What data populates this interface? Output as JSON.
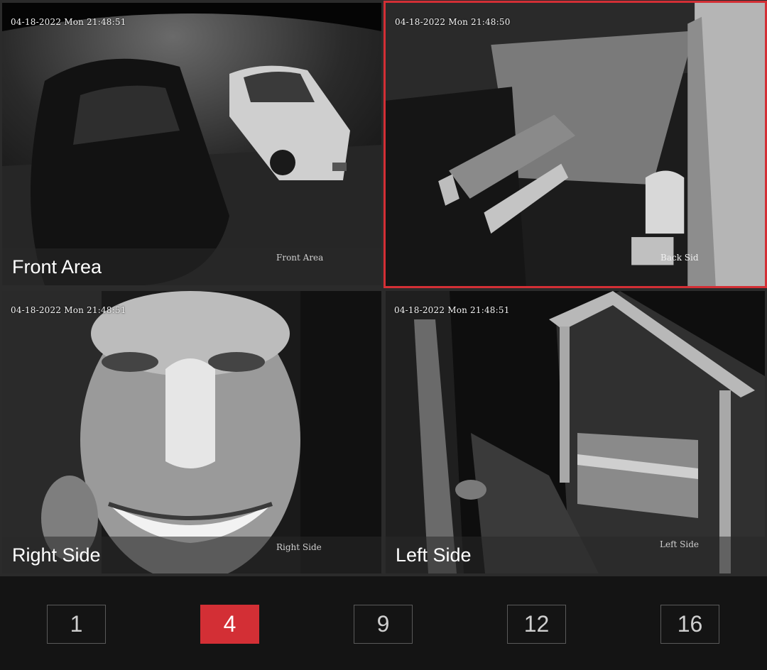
{
  "cameras": [
    {
      "timestamp": "04-18-2022 Mon 21:48:51",
      "osd_name": "Front Area",
      "label": "Front Area",
      "selected": false
    },
    {
      "timestamp": "04-18-2022 Mon 21:48:50",
      "osd_name": "Back Sid",
      "label": "",
      "selected": true
    },
    {
      "timestamp": "04-18-2022 Mon 21:48:51",
      "osd_name": "Right Side",
      "label": "Right Side",
      "selected": false
    },
    {
      "timestamp": "04-18-2022 Mon 21:48:51",
      "osd_name": "Left Side",
      "label": "Left Side",
      "selected": false
    }
  ],
  "layout_options": [
    {
      "label": "1"
    },
    {
      "label": "4",
      "active": true
    },
    {
      "label": "9"
    },
    {
      "label": "12"
    },
    {
      "label": "16"
    }
  ],
  "colors": {
    "accent": "#d32f35",
    "background": "#141414"
  }
}
